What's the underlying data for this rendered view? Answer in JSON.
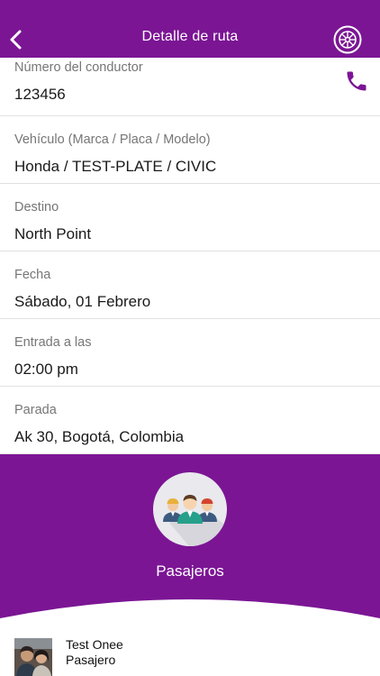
{
  "header": {
    "title": "Detalle de ruta",
    "back_icon": "chevron-left-icon",
    "right_icon": "steering-wheel-icon"
  },
  "fields": [
    {
      "label": "Número del conductor",
      "value": "123456"
    },
    {
      "label": "Vehículo (Marca / Placa / Modelo)",
      "value": "Honda / TEST-PLATE / CIVIC"
    },
    {
      "label": "Destino",
      "value": "North Point"
    },
    {
      "label": "Fecha",
      "value": "Sábado, 01 Febrero"
    },
    {
      "label": "Entrada a las",
      "value": "02:00 pm"
    },
    {
      "label": "Parada",
      "value": "Ak 30, Bogotá, Colombia"
    }
  ],
  "passengers_panel": {
    "label": "Pasajeros"
  },
  "passengers": [
    {
      "name": "Test Onee",
      "role": "Pasajero"
    }
  ],
  "colors": {
    "primary": "#7b1594",
    "divider": "#e1e1e1",
    "label": "#767676"
  }
}
